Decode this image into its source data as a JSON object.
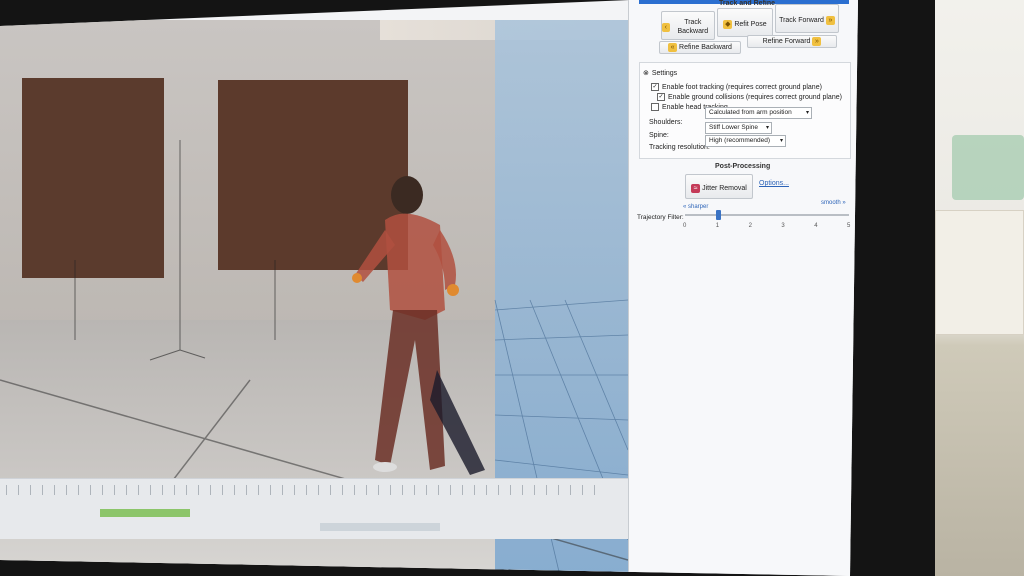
{
  "panel": {
    "section_track": "Track and Refine",
    "track_backward": "Track Backward",
    "refit_pose": "Refit Pose",
    "track_forward": "Track Forward",
    "refine_backward": "Refine Backward",
    "refine_forward": "Refine Forward",
    "settings_title": "Settings",
    "checkboxes": [
      {
        "label": "Enable foot tracking (requires correct ground plane)",
        "checked": true
      },
      {
        "label": "Enable ground collisions (requires correct ground plane)",
        "checked": true
      },
      {
        "label": "Enable head tracking",
        "checked": false
      }
    ],
    "shoulders_label": "Shoulders:",
    "shoulders_value": "Calculated from arm position",
    "spine_label": "Spine:",
    "spine_value": "Stiff Lower Spine",
    "resolution_label": "Tracking resolution:",
    "resolution_value": "High (recommended)",
    "post_processing_title": "Post-Processing",
    "jitter_removal": "Jitter Removal",
    "options_link": "Options...",
    "sharper": "« sharper",
    "smoother": "smooth »",
    "trajectory_filter_label": "Trajectory Filter:",
    "filter_ticks": [
      "0",
      "1",
      "2",
      "3",
      "4",
      "5"
    ],
    "filter_value": 1
  },
  "colors": {
    "accent": "#2d64b8",
    "avatar": "#b0503f",
    "ground_plane": "#8fb4d6"
  }
}
